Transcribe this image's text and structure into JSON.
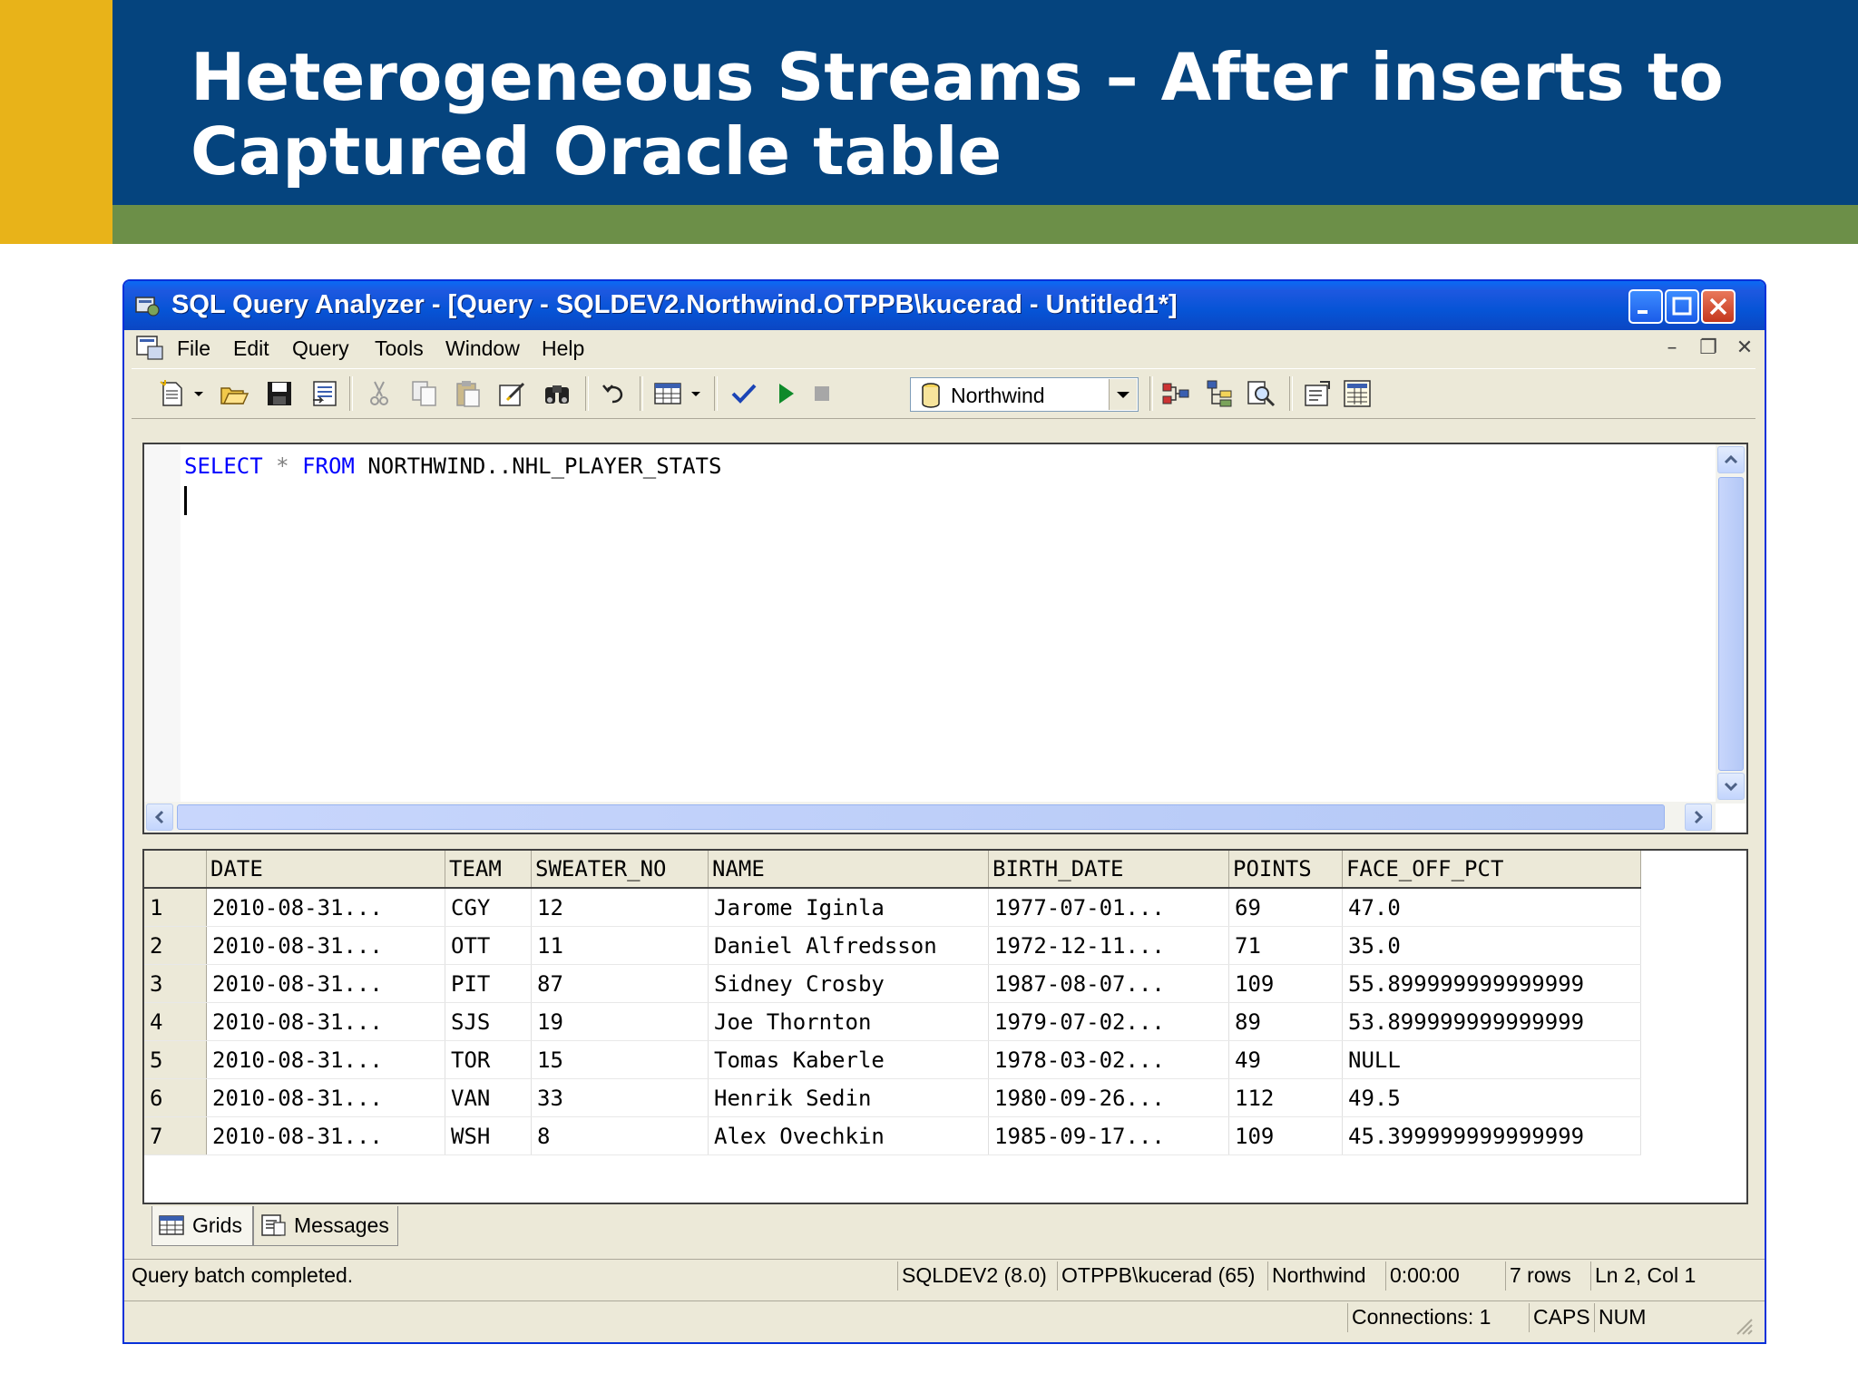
{
  "slide": {
    "title": "Heterogeneous Streams – After inserts to Captured Oracle table",
    "colors": {
      "banner": "#05447e",
      "accent": "#e8b319",
      "stripe": "#6c8f48"
    }
  },
  "window": {
    "title": "SQL Query Analyzer - [Query - SQLDEV2.Northwind.OTPPB\\kucerad - Untitled1*]",
    "menu": [
      "File",
      "Edit",
      "Query",
      "Tools",
      "Window",
      "Help"
    ],
    "database": "Northwind"
  },
  "toolbar_icons": [
    "new-query-icon",
    "open-icon",
    "save-icon",
    "load-script-icon",
    "cut-icon",
    "copy-icon",
    "paste-icon",
    "clear-icon",
    "find-icon",
    "undo-icon",
    "results-grid-icon",
    "parse-check-icon",
    "execute-icon",
    "stop-icon",
    "database-icon",
    "execution-plan-icon",
    "object-browser-icon",
    "object-search-icon",
    "properties-icon",
    "show-results-icon"
  ],
  "editor": {
    "kw_select": "SELECT",
    "star": "*",
    "kw_from": "FROM",
    "table": "NORTHWIND..NHL_PLAYER_STATS"
  },
  "results": {
    "columns": [
      "DATE",
      "TEAM",
      "SWEATER_NO",
      "NAME",
      "BIRTH_DATE",
      "POINTS",
      "FACE_OFF_PCT"
    ],
    "rows": [
      [
        "1",
        "2010-08-31...",
        "CGY",
        "12",
        "Jarome Iginla",
        "1977-07-01...",
        "69",
        "47.0"
      ],
      [
        "2",
        "2010-08-31...",
        "OTT",
        "11",
        "Daniel Alfredsson",
        "1972-12-11...",
        "71",
        "35.0"
      ],
      [
        "3",
        "2010-08-31...",
        "PIT",
        "87",
        "Sidney Crosby",
        "1987-08-07...",
        "109",
        "55.899999999999999"
      ],
      [
        "4",
        "2010-08-31...",
        "SJS",
        "19",
        "Joe Thornton",
        "1979-07-02...",
        "89",
        "53.899999999999999"
      ],
      [
        "5",
        "2010-08-31...",
        "TOR",
        "15",
        "Tomas Kaberle",
        "1978-03-02...",
        "49",
        "NULL"
      ],
      [
        "6",
        "2010-08-31...",
        "VAN",
        "33",
        "Henrik Sedin",
        "1980-09-26...",
        "112",
        "49.5"
      ],
      [
        "7",
        "2010-08-31...",
        "WSH",
        "8",
        "Alex Ovechkin",
        "1985-09-17...",
        "109",
        "45.399999999999999"
      ]
    ]
  },
  "tabs": {
    "grids": "Grids",
    "messages": "Messages"
  },
  "status": {
    "message": "Query batch completed.",
    "server": "SQLDEV2 (8.0)",
    "user": "OTPPB\\kucerad (65)",
    "database": "Northwind",
    "elapsed": "0:00:00",
    "rows": "7 rows",
    "position": "Ln 2, Col 1",
    "connections": "Connections: 1",
    "caps": "CAPS",
    "num": "NUM"
  }
}
